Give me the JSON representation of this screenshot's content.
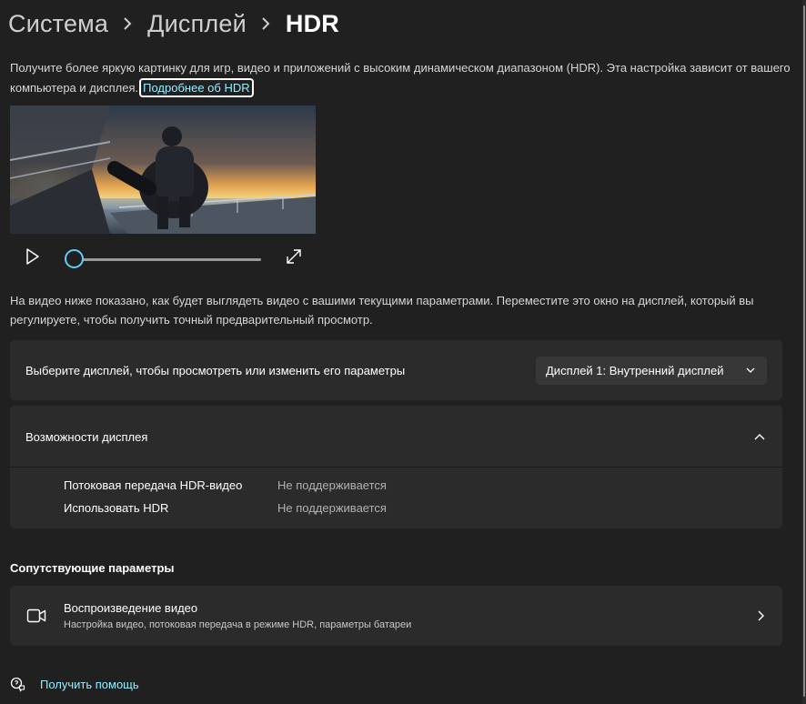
{
  "breadcrumb": {
    "items": [
      "Система",
      "Дисплей"
    ],
    "current": "HDR"
  },
  "intro": {
    "text": "Получите более яркую картинку для игр, видео и приложений с высоким динамическом диапазоном (HDR). Эта настройка зависит от вашего компьютера и дисплея.",
    "link": "Подробнее об HDR"
  },
  "player": {
    "play_icon": "play-icon",
    "expand_icon": "expand-icon",
    "position": 0.0
  },
  "preview_note": "На видео ниже показано, как будет выглядеть видео с вашими текущими параметрами. Переместите это окно на дисплей, который вы регулируете, чтобы получить точный предварительный просмотр.",
  "display_select": {
    "label": "Выберите дисплей, чтобы просмотреть или изменить его параметры",
    "value": "Дисплей 1: Внутренний дисплей"
  },
  "capabilities": {
    "title": "Возможности дисплея",
    "rows": [
      {
        "name": "Потоковая передача HDR-видео",
        "value": "Не поддерживается"
      },
      {
        "name": "Использовать HDR",
        "value": "Не поддерживается"
      }
    ]
  },
  "related": {
    "title": "Сопутствующие параметры",
    "video_playback": {
      "title": "Воспроизведение видео",
      "subtitle": "Настройка видео, потоковая передача в режиме HDR, параметры батареи"
    }
  },
  "help": {
    "label": "Получить помощь"
  },
  "colors": {
    "accent": "#60cdff",
    "link": "#99ebff",
    "background": "#202020",
    "card": "#2b2b2b"
  }
}
